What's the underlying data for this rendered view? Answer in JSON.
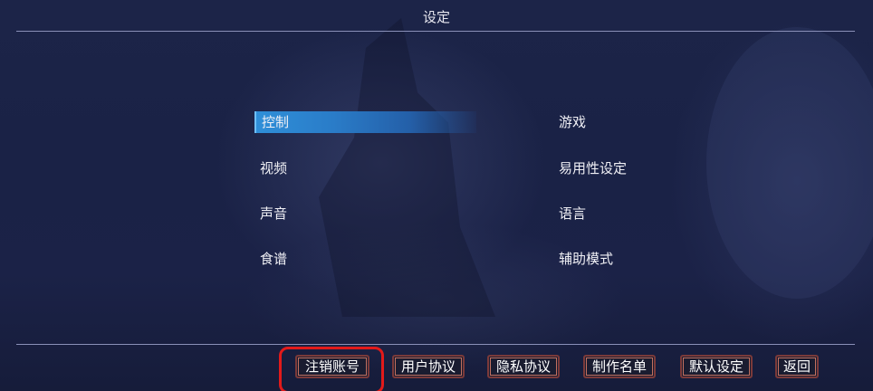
{
  "screen": {
    "title": "设定"
  },
  "menu": {
    "left": [
      {
        "label": "控制",
        "selected": true
      },
      {
        "label": "视频",
        "selected": false
      },
      {
        "label": "声音",
        "selected": false
      },
      {
        "label": "食谱",
        "selected": false
      }
    ],
    "right": [
      {
        "label": "游戏"
      },
      {
        "label": "易用性设定"
      },
      {
        "label": "语言"
      },
      {
        "label": "辅助模式"
      }
    ]
  },
  "footer": {
    "buttons": [
      {
        "label": "注销账号"
      },
      {
        "label": "用户协议"
      },
      {
        "label": "隐私协议"
      },
      {
        "label": "制作名单"
      },
      {
        "label": "默认设定"
      },
      {
        "label": "返回"
      }
    ]
  },
  "colors": {
    "accent": "#2f8fd8",
    "background": "#1a2145",
    "annotation": "#e21a1a"
  }
}
